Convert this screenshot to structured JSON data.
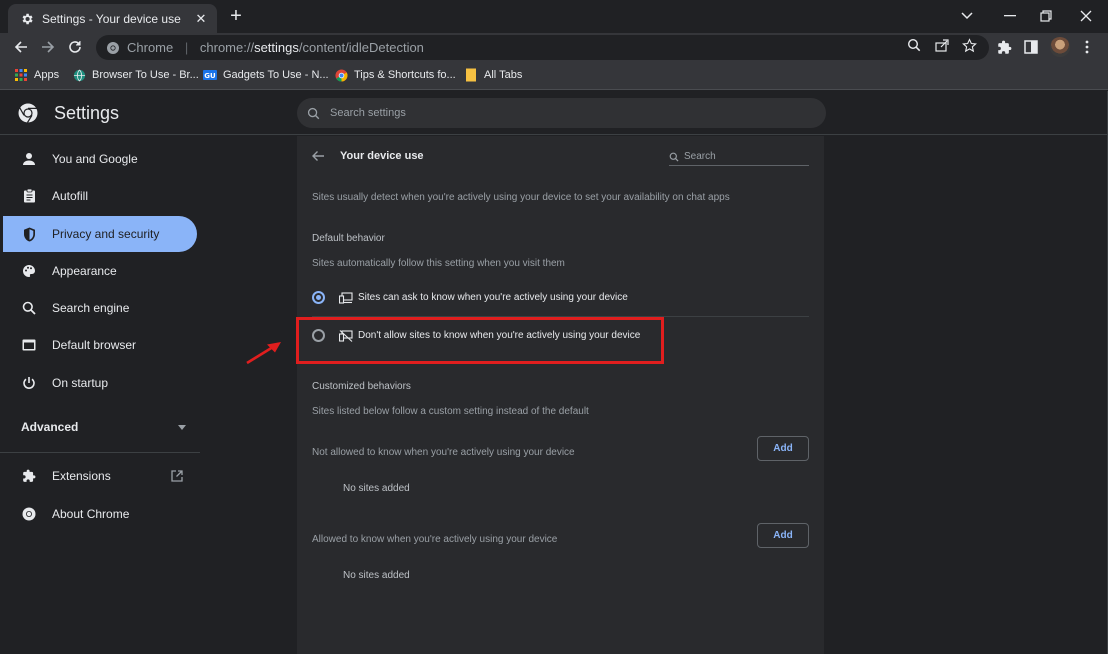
{
  "browser": {
    "tab_title": "Settings - Your device use",
    "tab_close": "✕",
    "new_tab": "+",
    "omnibox_prefix": "Chrome",
    "omnibox_separator": "|",
    "url_scheme": "chrome://",
    "url_host": "settings",
    "url_path": "/content/idleDetection"
  },
  "bookmarks": [
    {
      "label": "Apps",
      "icon": "apps-grid-icon"
    },
    {
      "label": "Browser To Use - Br...",
      "icon": "globe-icon"
    },
    {
      "label": "Gadgets To Use - N...",
      "icon": "gtu-logo-icon"
    },
    {
      "label": "Tips & Shortcuts fo...",
      "icon": "chrome-logo-icon"
    },
    {
      "label": "All Tabs",
      "icon": "folder-icon"
    }
  ],
  "settings": {
    "title": "Settings",
    "search_placeholder": "Search settings"
  },
  "sidebar": {
    "items": [
      {
        "label": "You and Google",
        "icon": "person-icon"
      },
      {
        "label": "Autofill",
        "icon": "clipboard-icon"
      },
      {
        "label": "Privacy and security",
        "icon": "shield-icon",
        "active": true
      },
      {
        "label": "Appearance",
        "icon": "palette-icon"
      },
      {
        "label": "Search engine",
        "icon": "search-icon"
      },
      {
        "label": "Default browser",
        "icon": "browser-window-icon"
      },
      {
        "label": "On startup",
        "icon": "power-icon"
      }
    ],
    "advanced_label": "Advanced",
    "extensions_label": "Extensions",
    "about_label": "About Chrome"
  },
  "page": {
    "title": "Your device use",
    "search_placeholder": "Search",
    "description": "Sites usually detect when you're actively using your device to set your availability on chat apps",
    "default_behavior_heading": "Default behavior",
    "default_behavior_sub": "Sites automatically follow this setting when you visit them",
    "options": [
      {
        "label": "Sites can ask to know when you're actively using your device",
        "selected": true
      },
      {
        "label": "Don't allow sites to know when you're actively using your device",
        "selected": false
      }
    ],
    "customized_heading": "Customized behaviors",
    "customized_sub": "Sites listed below follow a custom setting instead of the default",
    "not_allowed_label": "Not allowed to know when you're actively using your device",
    "allowed_label": "Allowed to know when you're actively using your device",
    "add_label": "Add",
    "no_sites_label": "No sites added"
  },
  "colors": {
    "accent": "#8ab4f8",
    "highlight_box": "#e01e1e",
    "background": "#202124",
    "card": "#292a2d"
  }
}
